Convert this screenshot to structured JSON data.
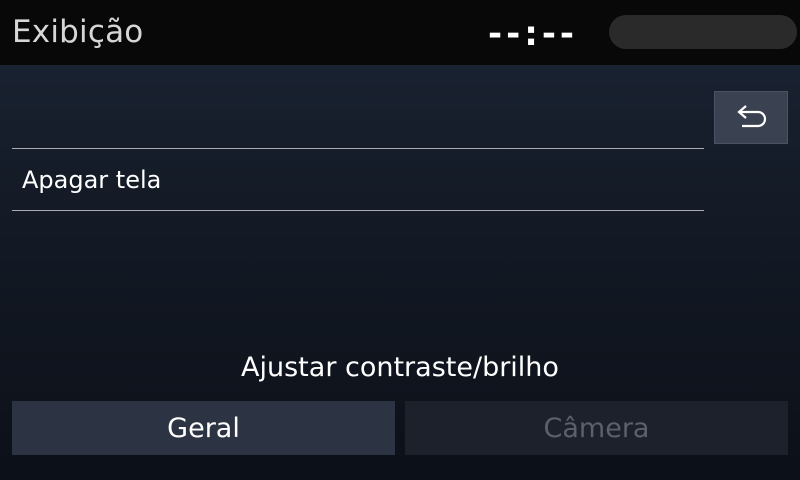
{
  "header": {
    "title": "Exibição",
    "clock": "--:--"
  },
  "list": {
    "items": [
      {
        "label": "Apagar tela"
      }
    ]
  },
  "section": {
    "label": "Ajustar contraste/brilho"
  },
  "tabs": [
    {
      "label": "Geral",
      "state": "enabled"
    },
    {
      "label": "Câmera",
      "state": "disabled"
    }
  ],
  "icons": {
    "back": "back-arrow-icon"
  },
  "colors": {
    "header_bg": "#080808",
    "button_bg": "#2c3443",
    "disabled_text": "#5b606a"
  }
}
